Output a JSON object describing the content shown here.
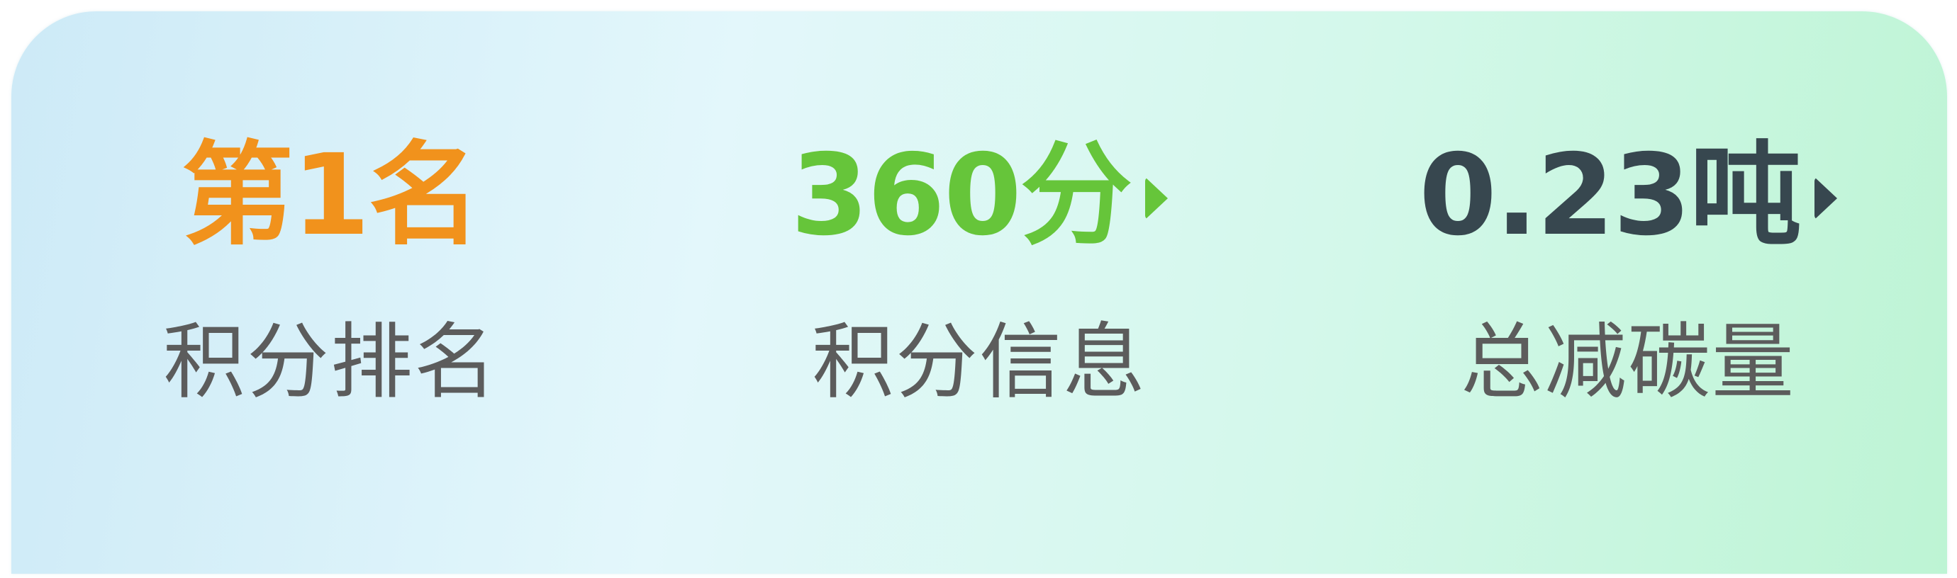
{
  "stats": {
    "rank": {
      "value": "第1名",
      "label": "积分排名",
      "color": "#f1921c"
    },
    "points": {
      "value": "360分",
      "label": "积分信息",
      "color": "#66c53a",
      "icon": "caret-right-icon"
    },
    "carbon": {
      "value": "0.23吨",
      "label": "总减碳量",
      "color": "#37474f",
      "icon": "caret-right-icon"
    }
  }
}
